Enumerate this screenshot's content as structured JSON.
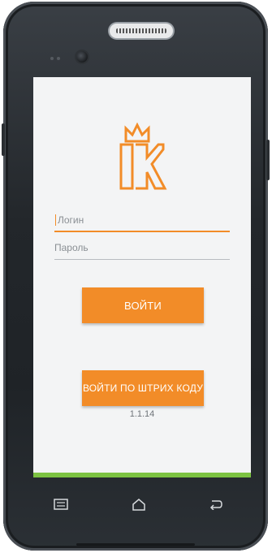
{
  "login": {
    "username_placeholder": "Логин",
    "password_placeholder": "Пароль",
    "login_button": "ВОЙТИ",
    "barcode_button": "ВОЙТИ ПО ШТРИХ КОДУ",
    "version": "1.1.14"
  },
  "colors": {
    "accent": "#f28c28",
    "bottom_bar": "#7cc242",
    "screen_bg": "#f3f4f5"
  },
  "icons": {
    "logo": "ik-crown-logo-icon",
    "nav_menu": "menu-icon",
    "nav_home": "home-icon",
    "nav_back": "back-icon"
  }
}
